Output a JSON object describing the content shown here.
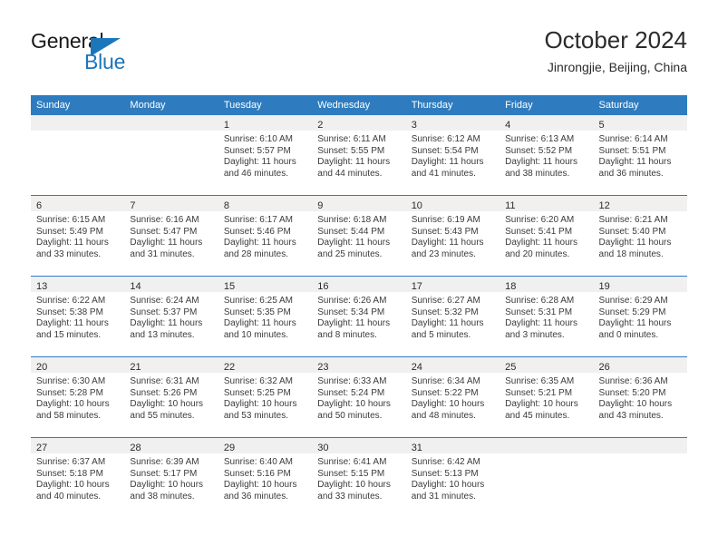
{
  "logo": {
    "text_primary": "General",
    "text_secondary": "Blue",
    "triangle_icon": "triangle-flag-icon",
    "primary_color": "#1a1a1a",
    "accent_color": "#1b76bc"
  },
  "header": {
    "title": "October 2024",
    "subtitle": "Jinrongjie, Beijing, China"
  },
  "theme": {
    "header_bg": "#2e7cbf",
    "header_text": "#ffffff",
    "daynum_strip_bg": "#f0f0f0",
    "cell_bg": "#ffffff",
    "text": "#3b3b3b"
  },
  "weekday_headers": [
    "Sunday",
    "Monday",
    "Tuesday",
    "Wednesday",
    "Thursday",
    "Friday",
    "Saturday"
  ],
  "weeks": [
    [
      {
        "day": "",
        "sunrise": "",
        "sunset": "",
        "daylight_line1": "",
        "daylight_line2": ""
      },
      {
        "day": "",
        "sunrise": "",
        "sunset": "",
        "daylight_line1": "",
        "daylight_line2": ""
      },
      {
        "day": "1",
        "sunrise": "Sunrise: 6:10 AM",
        "sunset": "Sunset: 5:57 PM",
        "daylight_line1": "Daylight: 11 hours",
        "daylight_line2": "and 46 minutes."
      },
      {
        "day": "2",
        "sunrise": "Sunrise: 6:11 AM",
        "sunset": "Sunset: 5:55 PM",
        "daylight_line1": "Daylight: 11 hours",
        "daylight_line2": "and 44 minutes."
      },
      {
        "day": "3",
        "sunrise": "Sunrise: 6:12 AM",
        "sunset": "Sunset: 5:54 PM",
        "daylight_line1": "Daylight: 11 hours",
        "daylight_line2": "and 41 minutes."
      },
      {
        "day": "4",
        "sunrise": "Sunrise: 6:13 AM",
        "sunset": "Sunset: 5:52 PM",
        "daylight_line1": "Daylight: 11 hours",
        "daylight_line2": "and 38 minutes."
      },
      {
        "day": "5",
        "sunrise": "Sunrise: 6:14 AM",
        "sunset": "Sunset: 5:51 PM",
        "daylight_line1": "Daylight: 11 hours",
        "daylight_line2": "and 36 minutes."
      }
    ],
    [
      {
        "day": "6",
        "sunrise": "Sunrise: 6:15 AM",
        "sunset": "Sunset: 5:49 PM",
        "daylight_line1": "Daylight: 11 hours",
        "daylight_line2": "and 33 minutes."
      },
      {
        "day": "7",
        "sunrise": "Sunrise: 6:16 AM",
        "sunset": "Sunset: 5:47 PM",
        "daylight_line1": "Daylight: 11 hours",
        "daylight_line2": "and 31 minutes."
      },
      {
        "day": "8",
        "sunrise": "Sunrise: 6:17 AM",
        "sunset": "Sunset: 5:46 PM",
        "daylight_line1": "Daylight: 11 hours",
        "daylight_line2": "and 28 minutes."
      },
      {
        "day": "9",
        "sunrise": "Sunrise: 6:18 AM",
        "sunset": "Sunset: 5:44 PM",
        "daylight_line1": "Daylight: 11 hours",
        "daylight_line2": "and 25 minutes."
      },
      {
        "day": "10",
        "sunrise": "Sunrise: 6:19 AM",
        "sunset": "Sunset: 5:43 PM",
        "daylight_line1": "Daylight: 11 hours",
        "daylight_line2": "and 23 minutes."
      },
      {
        "day": "11",
        "sunrise": "Sunrise: 6:20 AM",
        "sunset": "Sunset: 5:41 PM",
        "daylight_line1": "Daylight: 11 hours",
        "daylight_line2": "and 20 minutes."
      },
      {
        "day": "12",
        "sunrise": "Sunrise: 6:21 AM",
        "sunset": "Sunset: 5:40 PM",
        "daylight_line1": "Daylight: 11 hours",
        "daylight_line2": "and 18 minutes."
      }
    ],
    [
      {
        "day": "13",
        "sunrise": "Sunrise: 6:22 AM",
        "sunset": "Sunset: 5:38 PM",
        "daylight_line1": "Daylight: 11 hours",
        "daylight_line2": "and 15 minutes."
      },
      {
        "day": "14",
        "sunrise": "Sunrise: 6:24 AM",
        "sunset": "Sunset: 5:37 PM",
        "daylight_line1": "Daylight: 11 hours",
        "daylight_line2": "and 13 minutes."
      },
      {
        "day": "15",
        "sunrise": "Sunrise: 6:25 AM",
        "sunset": "Sunset: 5:35 PM",
        "daylight_line1": "Daylight: 11 hours",
        "daylight_line2": "and 10 minutes."
      },
      {
        "day": "16",
        "sunrise": "Sunrise: 6:26 AM",
        "sunset": "Sunset: 5:34 PM",
        "daylight_line1": "Daylight: 11 hours",
        "daylight_line2": "and 8 minutes."
      },
      {
        "day": "17",
        "sunrise": "Sunrise: 6:27 AM",
        "sunset": "Sunset: 5:32 PM",
        "daylight_line1": "Daylight: 11 hours",
        "daylight_line2": "and 5 minutes."
      },
      {
        "day": "18",
        "sunrise": "Sunrise: 6:28 AM",
        "sunset": "Sunset: 5:31 PM",
        "daylight_line1": "Daylight: 11 hours",
        "daylight_line2": "and 3 minutes."
      },
      {
        "day": "19",
        "sunrise": "Sunrise: 6:29 AM",
        "sunset": "Sunset: 5:29 PM",
        "daylight_line1": "Daylight: 11 hours",
        "daylight_line2": "and 0 minutes."
      }
    ],
    [
      {
        "day": "20",
        "sunrise": "Sunrise: 6:30 AM",
        "sunset": "Sunset: 5:28 PM",
        "daylight_line1": "Daylight: 10 hours",
        "daylight_line2": "and 58 minutes."
      },
      {
        "day": "21",
        "sunrise": "Sunrise: 6:31 AM",
        "sunset": "Sunset: 5:26 PM",
        "daylight_line1": "Daylight: 10 hours",
        "daylight_line2": "and 55 minutes."
      },
      {
        "day": "22",
        "sunrise": "Sunrise: 6:32 AM",
        "sunset": "Sunset: 5:25 PM",
        "daylight_line1": "Daylight: 10 hours",
        "daylight_line2": "and 53 minutes."
      },
      {
        "day": "23",
        "sunrise": "Sunrise: 6:33 AM",
        "sunset": "Sunset: 5:24 PM",
        "daylight_line1": "Daylight: 10 hours",
        "daylight_line2": "and 50 minutes."
      },
      {
        "day": "24",
        "sunrise": "Sunrise: 6:34 AM",
        "sunset": "Sunset: 5:22 PM",
        "daylight_line1": "Daylight: 10 hours",
        "daylight_line2": "and 48 minutes."
      },
      {
        "day": "25",
        "sunrise": "Sunrise: 6:35 AM",
        "sunset": "Sunset: 5:21 PM",
        "daylight_line1": "Daylight: 10 hours",
        "daylight_line2": "and 45 minutes."
      },
      {
        "day": "26",
        "sunrise": "Sunrise: 6:36 AM",
        "sunset": "Sunset: 5:20 PM",
        "daylight_line1": "Daylight: 10 hours",
        "daylight_line2": "and 43 minutes."
      }
    ],
    [
      {
        "day": "27",
        "sunrise": "Sunrise: 6:37 AM",
        "sunset": "Sunset: 5:18 PM",
        "daylight_line1": "Daylight: 10 hours",
        "daylight_line2": "and 40 minutes."
      },
      {
        "day": "28",
        "sunrise": "Sunrise: 6:39 AM",
        "sunset": "Sunset: 5:17 PM",
        "daylight_line1": "Daylight: 10 hours",
        "daylight_line2": "and 38 minutes."
      },
      {
        "day": "29",
        "sunrise": "Sunrise: 6:40 AM",
        "sunset": "Sunset: 5:16 PM",
        "daylight_line1": "Daylight: 10 hours",
        "daylight_line2": "and 36 minutes."
      },
      {
        "day": "30",
        "sunrise": "Sunrise: 6:41 AM",
        "sunset": "Sunset: 5:15 PM",
        "daylight_line1": "Daylight: 10 hours",
        "daylight_line2": "and 33 minutes."
      },
      {
        "day": "31",
        "sunrise": "Sunrise: 6:42 AM",
        "sunset": "Sunset: 5:13 PM",
        "daylight_line1": "Daylight: 10 hours",
        "daylight_line2": "and 31 minutes."
      },
      {
        "day": "",
        "sunrise": "",
        "sunset": "",
        "daylight_line1": "",
        "daylight_line2": ""
      },
      {
        "day": "",
        "sunrise": "",
        "sunset": "",
        "daylight_line1": "",
        "daylight_line2": ""
      }
    ]
  ]
}
